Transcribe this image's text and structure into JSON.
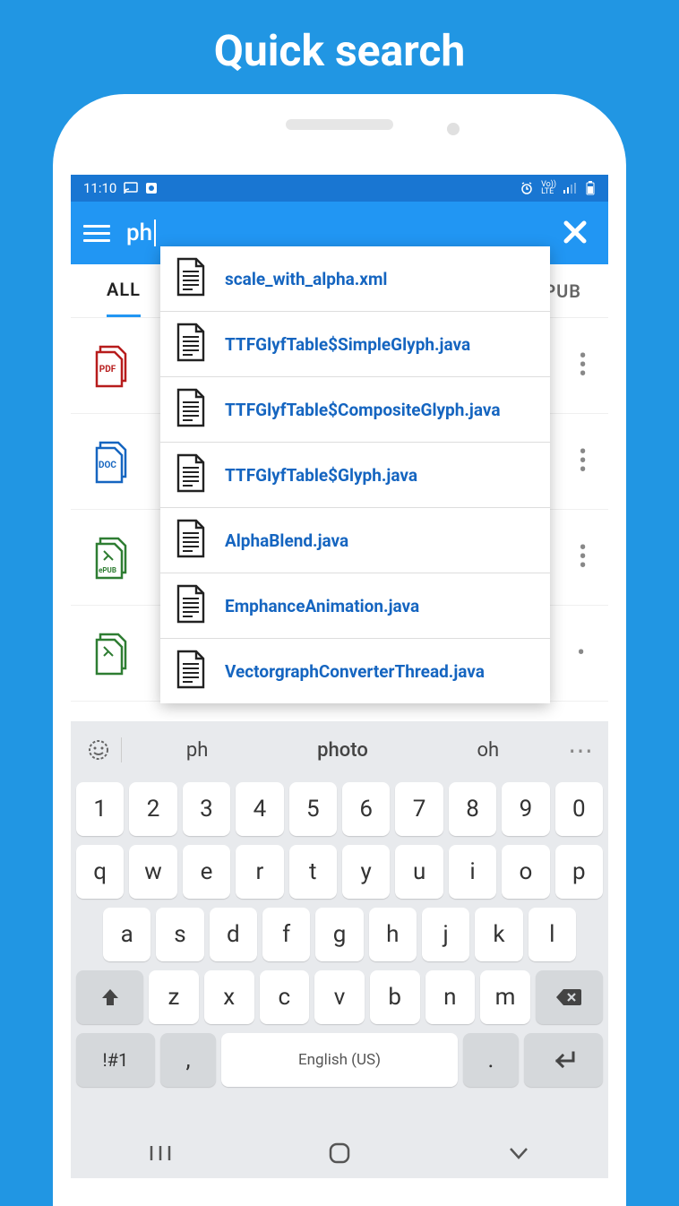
{
  "promo_title": "Quick search",
  "status": {
    "time": "11:10"
  },
  "header": {
    "search_value": "ph"
  },
  "tabs": {
    "left": "ALL",
    "right": "EPUB"
  },
  "bg_types": [
    "PDF",
    "DOC",
    "ePUB",
    "ePUB"
  ],
  "suggestions": [
    "scale_with_alpha.xml",
    "TTFGlyfTable$SimpleGlyph.java",
    "TTFGlyfTable$CompositeGlyph.java",
    "TTFGlyfTable$Glyph.java",
    "AlphaBlend.java",
    "EmphanceAnimation.java",
    "VectorgraphConverterThread.java"
  ],
  "keyboard": {
    "suggestions": [
      "ph",
      "photo",
      "oh"
    ],
    "row1": [
      "1",
      "2",
      "3",
      "4",
      "5",
      "6",
      "7",
      "8",
      "9",
      "0"
    ],
    "row2": [
      "q",
      "w",
      "e",
      "r",
      "t",
      "y",
      "u",
      "i",
      "o",
      "p"
    ],
    "row3": [
      "a",
      "s",
      "d",
      "f",
      "g",
      "h",
      "j",
      "k",
      "l"
    ],
    "row4": [
      "z",
      "x",
      "c",
      "v",
      "b",
      "n",
      "m"
    ],
    "symbol_key": "!#1",
    "comma": ",",
    "space_label": "English (US)",
    "period": "."
  }
}
